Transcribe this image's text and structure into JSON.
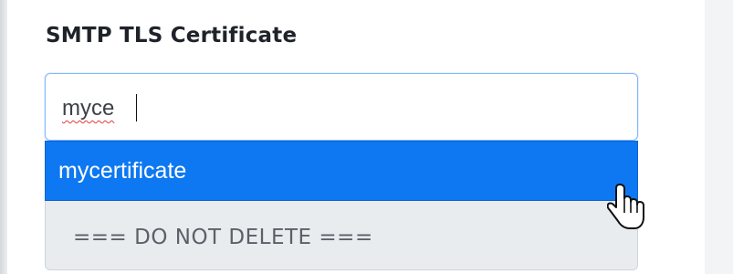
{
  "field": {
    "label": "SMTP TLS Certificate"
  },
  "input": {
    "value": "myce",
    "spellcheck_flag": "misspelled"
  },
  "dropdown": {
    "options": [
      {
        "label": "mycertificate",
        "state": "highlighted"
      },
      {
        "label": "=== DO NOT DELETE ===",
        "state": "disabled"
      }
    ]
  },
  "colors": {
    "highlight": "#0d78f2",
    "input_focus_border": "#86b7fe",
    "disabled_bg": "#e9ecef"
  },
  "cursor": {
    "icon": "hand-pointer-icon"
  }
}
